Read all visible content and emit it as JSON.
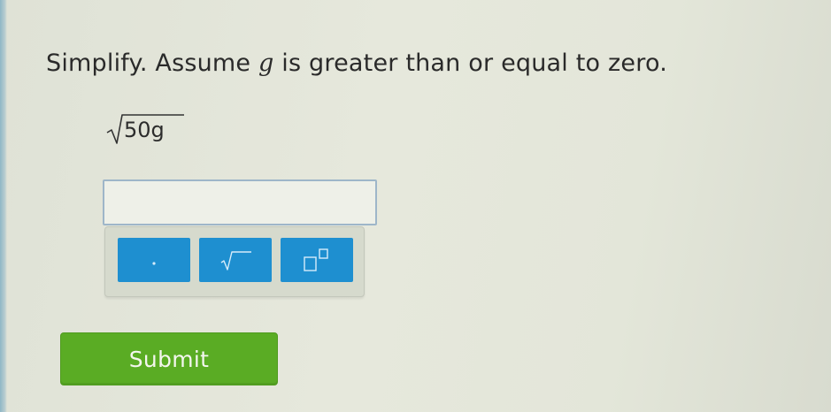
{
  "question": {
    "prompt_before": "Simplify. Assume ",
    "variable": "g",
    "prompt_after": " is greater than or equal to zero.",
    "expression_radicand": "50g"
  },
  "answer": {
    "value": ""
  },
  "keypad": {
    "keys": [
      {
        "name": "dot-key",
        "icon": "dot-icon"
      },
      {
        "name": "square-root-key",
        "icon": "square-root-icon"
      },
      {
        "name": "exponent-key",
        "icon": "exponent-icon"
      }
    ]
  },
  "submit": {
    "label": "Submit"
  },
  "colors": {
    "key_blue": "#1e8fd0",
    "submit_green": "#5aac24",
    "input_border": "#9eb6c9"
  }
}
